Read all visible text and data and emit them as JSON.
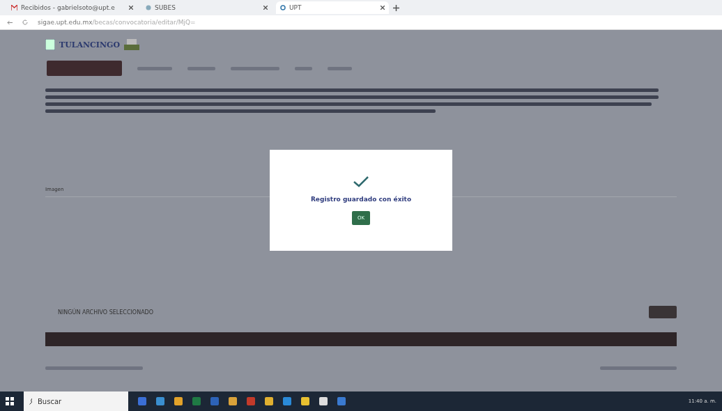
{
  "browser": {
    "tabs": [
      {
        "label": "Recibidos - gabrielsoto@upt.e",
        "selected": false,
        "kind": "mail"
      },
      {
        "label": "SUBES",
        "selected": false,
        "kind": "globe"
      },
      {
        "label": "UPT",
        "selected": true,
        "kind": "site"
      }
    ],
    "url_host": "sigae.upt.edu.mx",
    "url_path": "/becas/convocatoria/editar/MjQ="
  },
  "header": {
    "logo_text": "TULANCINGO"
  },
  "form": {
    "image_label": "Imagen",
    "file_status": "NINGÚN ARCHIVO SELECCIONADO"
  },
  "dialog": {
    "message": "Registro guardado con éxito",
    "button": "OK"
  },
  "taskbar": {
    "search_placeholder": "Buscar",
    "time": "11:40 a. m."
  }
}
